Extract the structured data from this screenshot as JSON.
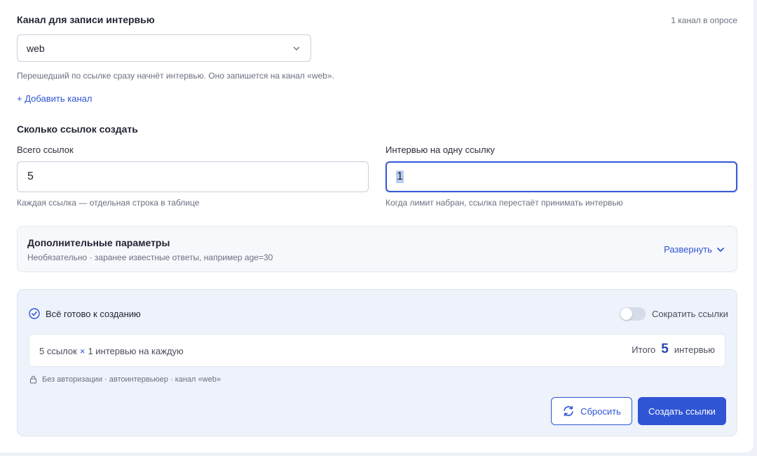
{
  "channel": {
    "title": "Канал для записи интервью",
    "count_label": "1 канал в опросе",
    "selected": "web",
    "hint": "Перешедший по ссылке сразу начнёт интервью. Оно запишется на канал «web».",
    "add_label": "+ Добавить канал"
  },
  "links": {
    "title": "Сколько ссылок создать",
    "total": {
      "label": "Всего ссылок",
      "value": "5",
      "hint": "Каждая ссылка — отдельная строка в таблице"
    },
    "per_link": {
      "label": "Интервью на одну ссылку",
      "value": "1",
      "hint": "Когда лимит набран, ссылка перестаёт принимать интервью"
    }
  },
  "extra": {
    "title": "Дополнительные параметры",
    "subtitle": "Необязательно · заранее известные ответы, например age=30",
    "expand_label": "Развернуть"
  },
  "summary": {
    "ready_label": "Всё готово к созданию",
    "shorten_label": "Сократить ссылки",
    "shorten_enabled": false,
    "calc_links": "5 ссылок",
    "calc_times": "×",
    "calc_per": "1 интервью на каждую",
    "total_prefix": "Итого",
    "total_value": "5",
    "total_suffix": "интервью",
    "meta": "Без авторизации · автоинтервьюер · канал «web»",
    "reset_label": "Сбросить",
    "create_label": "Создать ссылки"
  },
  "colors": {
    "accent": "#2f55d4",
    "panel_bg": "#f7f8fc",
    "summary_bg": "#eef2fb"
  }
}
